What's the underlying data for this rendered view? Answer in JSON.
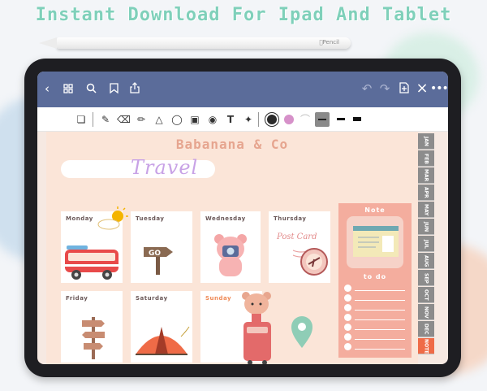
{
  "promo": {
    "headline": "Instant Download For Ipad And Tablet",
    "pencil_brand": "Pencil"
  },
  "colors": {
    "accent_mint": "#7fd0ba",
    "navbar": "#5b6c9a",
    "page_bg": "#fbe5d8",
    "note_panel": "#f4ad9e",
    "tab_active": "#ef6b47"
  },
  "navbar": {
    "left_icons": [
      "back-icon",
      "grid-icon",
      "search-icon",
      "bookmark-icon",
      "share-icon"
    ],
    "right_icons": [
      "undo-icon",
      "redo-icon",
      "add-page-icon",
      "close-icon",
      "more-icon"
    ]
  },
  "toolbar": {
    "tools": [
      "read-mode-icon",
      "pen-icon",
      "eraser-icon",
      "highlighter-icon",
      "shape-icon",
      "lasso-icon",
      "image-icon",
      "camera-icon",
      "text-icon",
      "laser-icon"
    ],
    "selected_color": "#2b2b2b",
    "alt_color": "#d691c9"
  },
  "planner": {
    "brand": "Babanana & Co",
    "title": "Travel",
    "days": [
      "Monday",
      "Tuesday",
      "Wednesday",
      "Thursday",
      "Friday",
      "Saturday",
      "Sunday"
    ],
    "note_label": "Note",
    "todo_label": "to do",
    "stickers": {
      "go_sign": "GO",
      "postcard": "Post Card"
    }
  },
  "month_tabs": [
    "JAN",
    "FEB",
    "MAR",
    "APR",
    "MAY",
    "JUN",
    "JUL",
    "AUG",
    "SEP",
    "OCT",
    "NOV",
    "DEC",
    "NOTE"
  ]
}
